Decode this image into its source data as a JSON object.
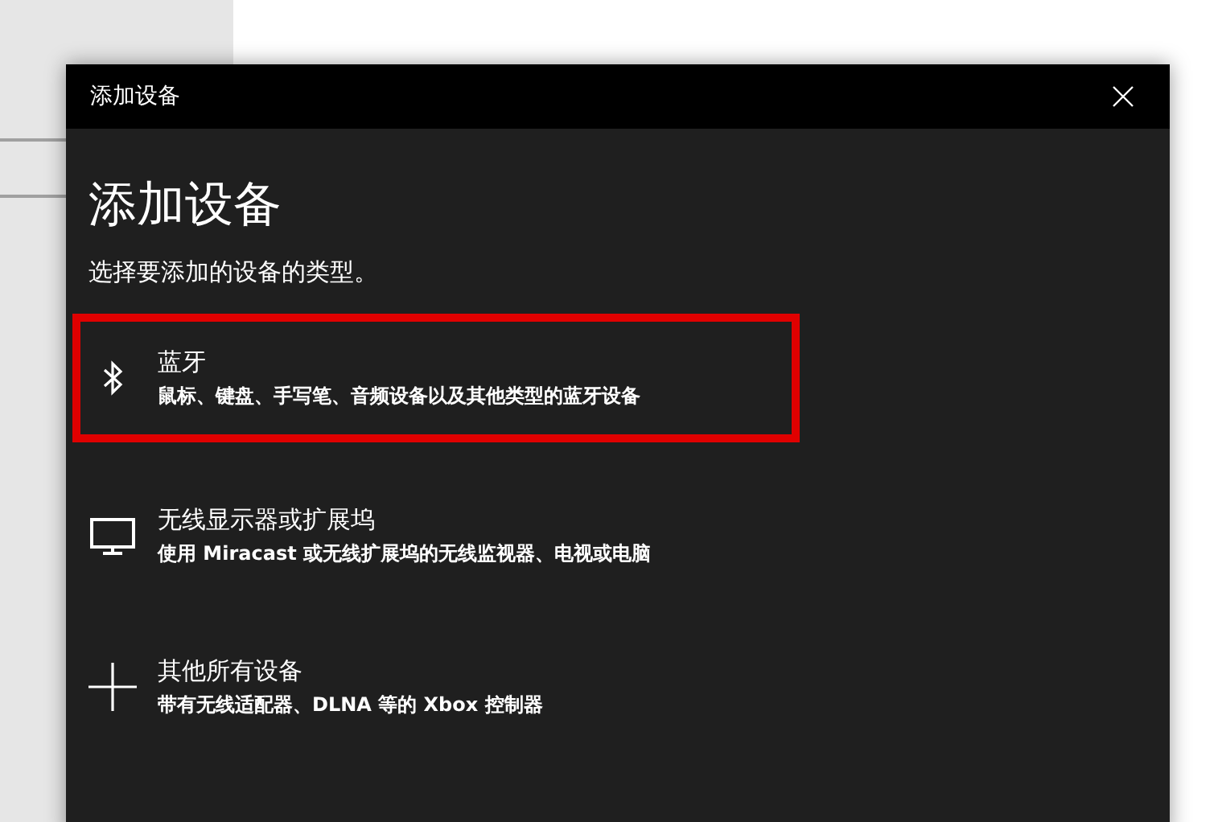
{
  "dialog": {
    "title": "添加设备",
    "heading": "添加设备",
    "subtitle": "选择要添加的设备的类型。",
    "options": [
      {
        "kind": "bluetooth",
        "title": "蓝牙",
        "description": "鼠标、键盘、手写笔、音频设备以及其他类型的蓝牙设备",
        "selected": true
      },
      {
        "kind": "display",
        "title": "无线显示器或扩展坞",
        "description": "使用 Miracast 或无线扩展坞的无线监视器、电视或电脑",
        "selected": false
      },
      {
        "kind": "other",
        "title": "其他所有设备",
        "description": "带有无线适配器、DLNA 等的 Xbox 控制器",
        "selected": false
      }
    ]
  }
}
